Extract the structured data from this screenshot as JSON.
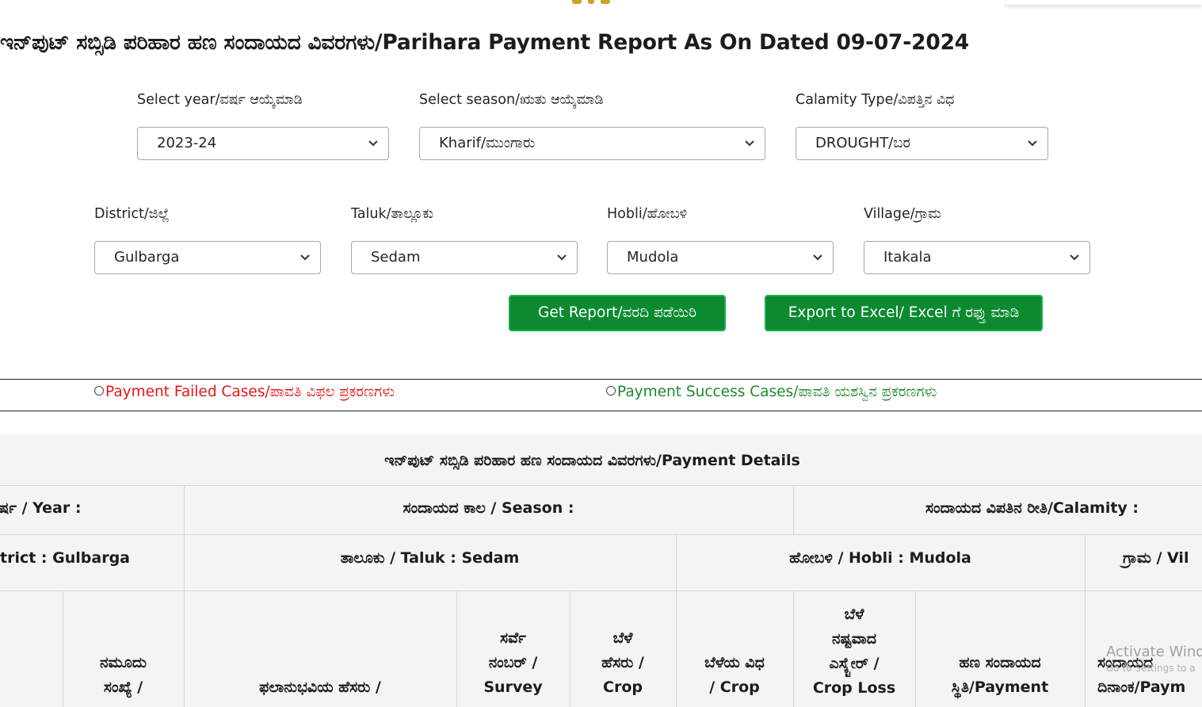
{
  "title": "ಇನ್‌ಪುಟ್ ಸಬ್ಸಿಡಿ ಪರಿಹಾರ ಹಣ ಸಂದಾಯದ ವಿವರಗಳು/Parihara Payment Report As On Dated 09-07-2024",
  "filters": {
    "year": {
      "label": "Select year/ವರ್ಷ ಆಯ್ಕೆಮಾಡಿ",
      "value": "2023-24"
    },
    "season": {
      "label": "Select season/ಋತು ಆಯ್ಕೆಮಾಡಿ",
      "value": "Kharif/ಮುಂಗಾರು"
    },
    "calamity": {
      "label": "Calamity Type/ವಿಪತ್ತಿನ ವಿಧ",
      "value": "DROUGHT/ಬರ"
    },
    "district": {
      "label": "District/ಜಿಲ್ಲೆ",
      "value": "Gulbarga"
    },
    "taluk": {
      "label": "Taluk/ತಾಲ್ಲೂಕು",
      "value": "Sedam"
    },
    "hobli": {
      "label": "Hobli/ಹೋಬಳಿ",
      "value": "Mudola"
    },
    "village": {
      "label": "Village/ಗ್ರಾಮ",
      "value": "Itakala"
    }
  },
  "buttons": {
    "get_report": "Get Report/ವರದಿ ಪಡೆಯಿರಿ",
    "export_excel": "Export to Excel/ Excel ಗೆ ರಫ್ತು ಮಾಡಿ"
  },
  "radios": {
    "failed": "Payment Failed Cases/ಪಾವತಿ ವಿಫಲ ಪ್ರಕರಣಗಳು",
    "success": "Payment Success Cases/ಪಾವತಿ ಯಶಸ್ವಿನ ಪ್ರಕರಣಗಳು"
  },
  "table": {
    "title": "ಇನ್‌ಪುಟ್ ಸಬ್ಸಿಡಿ ಪರಿಹಾರ ಹಣ ಸಂದಾಯದ ವಿವರಗಳು/Payment Details",
    "row1": {
      "year": "ವರ್ಷ / Year :",
      "season": "ಸಂದಾಯದ ಕಾಲ / Season :",
      "calamity": "ಸಂದಾಯದ ವಿಪತಿನ ರೀತಿ/Calamity :"
    },
    "row2": {
      "district": "trict : Gulbarga",
      "taluk": "ತಾಲೂಕು / Taluk : Sedam",
      "hobli": "ಹೋಬಳಿ / Hobli : Mudola",
      "village": "ಗ್ರಾಮ / Vil"
    },
    "headers": {
      "form_no": [
        "ನಮೂದು",
        "ಸಂಖ್ಯೆ /"
      ],
      "beneficiary": [
        "ಫಲಾನುಭವಿಯ ಹೆಸರು /"
      ],
      "survey": [
        "ಸರ್ವೆ",
        "ನಂಬರ್ /",
        "Survey"
      ],
      "crop_name": [
        "ಬೆಳೆ",
        "ಹೆಸರು /",
        "Crop"
      ],
      "crop_type": [
        "ಬೆಳೆಯ ವಿಧ",
        "/ Crop"
      ],
      "crop_loss": [
        "ಬೆಳೆ",
        "ನಷ್ಟವಾದ",
        "ಎಸ್ಕ್ಟೇರ್ /",
        "Crop Loss"
      ],
      "payment_status": [
        "ಹಣ ಸಂದಾಯದ",
        "ಸ್ಥಿತಿ/Payment"
      ],
      "payment_date": [
        "ಸಂದಾಯದ",
        "ದಿನಾಂಕ/Paym"
      ]
    }
  },
  "watermark": {
    "line1": "Activate Wind",
    "line2": "Go to Settings to a"
  }
}
